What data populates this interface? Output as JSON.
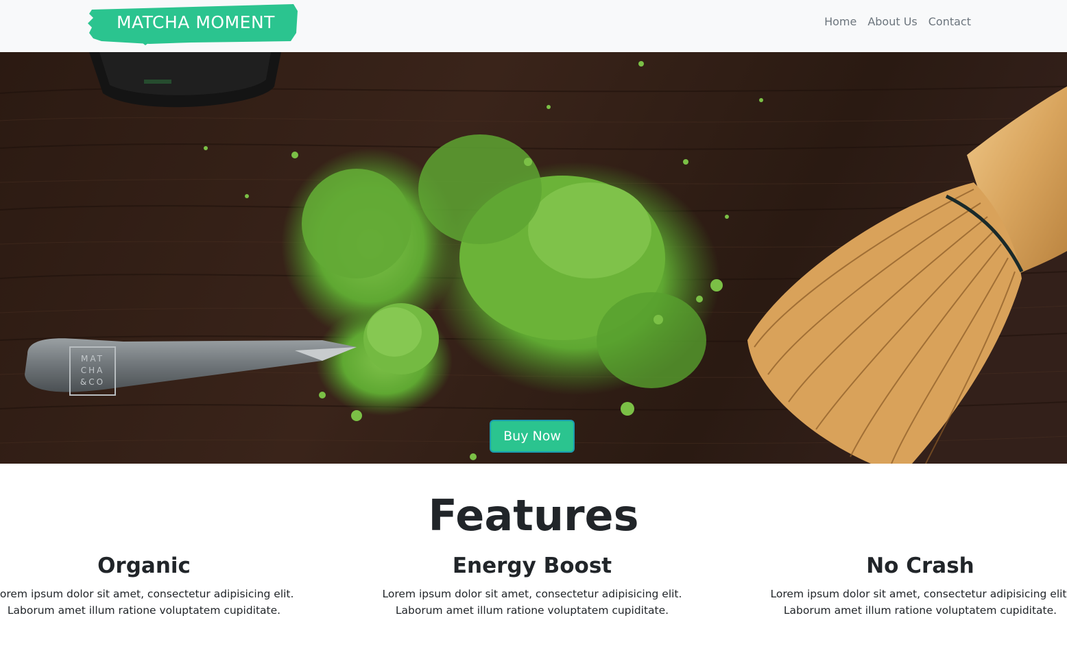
{
  "navbar": {
    "brand": "MATCHA MOMENT",
    "links": [
      "Home",
      "About Us",
      "Contact"
    ]
  },
  "hero": {
    "image": "matcha-powder-spoon-whisk-on-dark-wood",
    "spoon_logo": [
      "MAT",
      "CHA",
      "&CO"
    ],
    "buy_label": "Buy Now"
  },
  "features": {
    "title": "Features",
    "items": [
      {
        "title": "Organic",
        "line1": "Lorem ipsum dolor sit amet, consectetur adipisicing elit.",
        "line2": "Laborum amet illum ratione voluptatem cupiditate."
      },
      {
        "title": "Energy Boost",
        "line1": "Lorem ipsum dolor sit amet, consectetur adipisicing elit.",
        "line2": "Laborum amet illum ratione voluptatem cupiditate."
      },
      {
        "title": "No Crash",
        "line1": "Lorem ipsum dolor sit amet, consectetur adipisicing elit.",
        "line2": "Laborum amet illum ratione voluptatem cupiditate."
      }
    ]
  },
  "colors": {
    "accent": "#2bc48f",
    "navbar_bg": "#f8f9fa",
    "nav_link": "#6c757d",
    "heading": "#212529",
    "matcha": "#6cb33a"
  }
}
